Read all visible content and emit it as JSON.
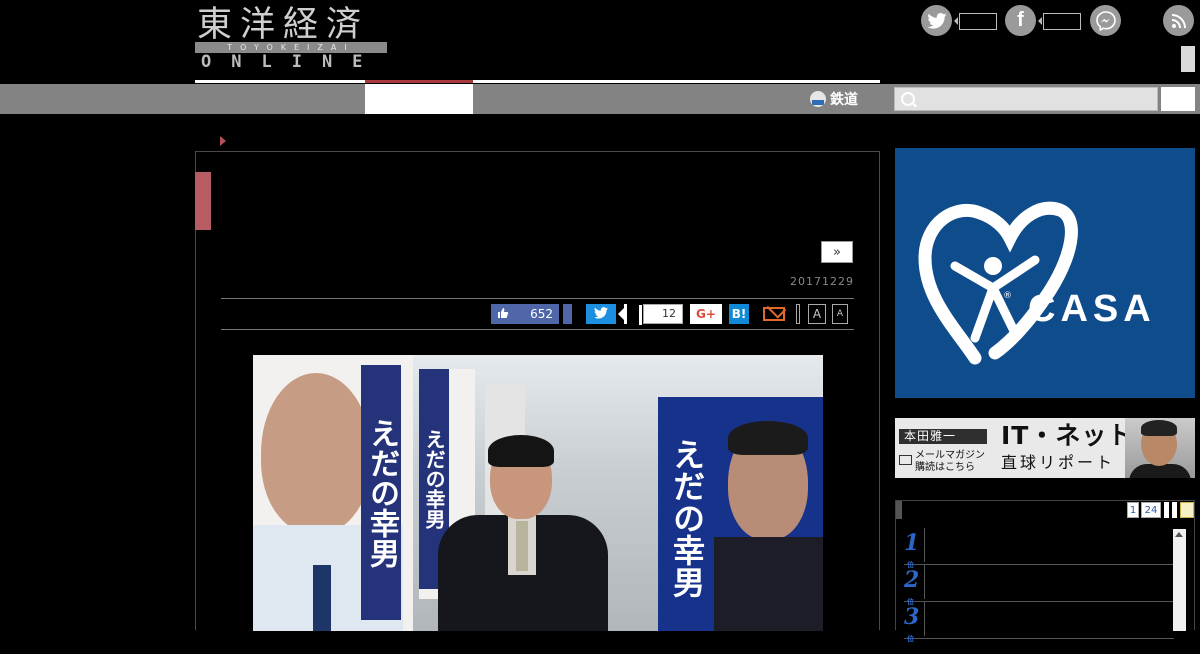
{
  "logo": {
    "kanji": "東洋経済",
    "romaji": "TOYOKEIZAI",
    "online": "ONLINE"
  },
  "header": {
    "social": [
      {
        "name": "twitter",
        "icon": "twitter-icon",
        "color": "#9a9a9a"
      },
      {
        "name": "facebook",
        "icon": "facebook-icon",
        "color": "#9a9a9a"
      },
      {
        "name": "messenger",
        "icon": "messenger-icon",
        "color": "#9a9a9a"
      },
      {
        "name": "rss",
        "icon": "rss-icon",
        "color": "#9a9a9a"
      }
    ]
  },
  "nav": {
    "rail_label": "鉄道",
    "search_placeholder": ""
  },
  "article": {
    "next_label": "»",
    "date": "20171229",
    "share": {
      "fb_like_count": "652",
      "hatena_count": "12",
      "gplus_label": "G+",
      "hatebu_label": "B!",
      "font_large": "A",
      "font_small": "A"
    },
    "photo": {
      "poster_text_left": "えだの幸男",
      "poster_text_mid": "えだの幸男",
      "poster_text_right": "えだの幸男"
    }
  },
  "sidebar": {
    "ad": {
      "brand": "CASA",
      "reg_mark": "®",
      "brand_color": "#0f4c8c"
    },
    "banner": {
      "author": "本田雅一",
      "title": "IT・ネット",
      "subtitle": "直球リポート",
      "mail_line1": "メールマガジン",
      "mail_line2": "購読はこちら"
    },
    "ranking": {
      "tabs": [
        "1",
        "24"
      ],
      "items": [
        {
          "rank": "1"
        },
        {
          "rank": "2"
        },
        {
          "rank": "3"
        }
      ],
      "rank_color": "#2a67c9"
    }
  }
}
